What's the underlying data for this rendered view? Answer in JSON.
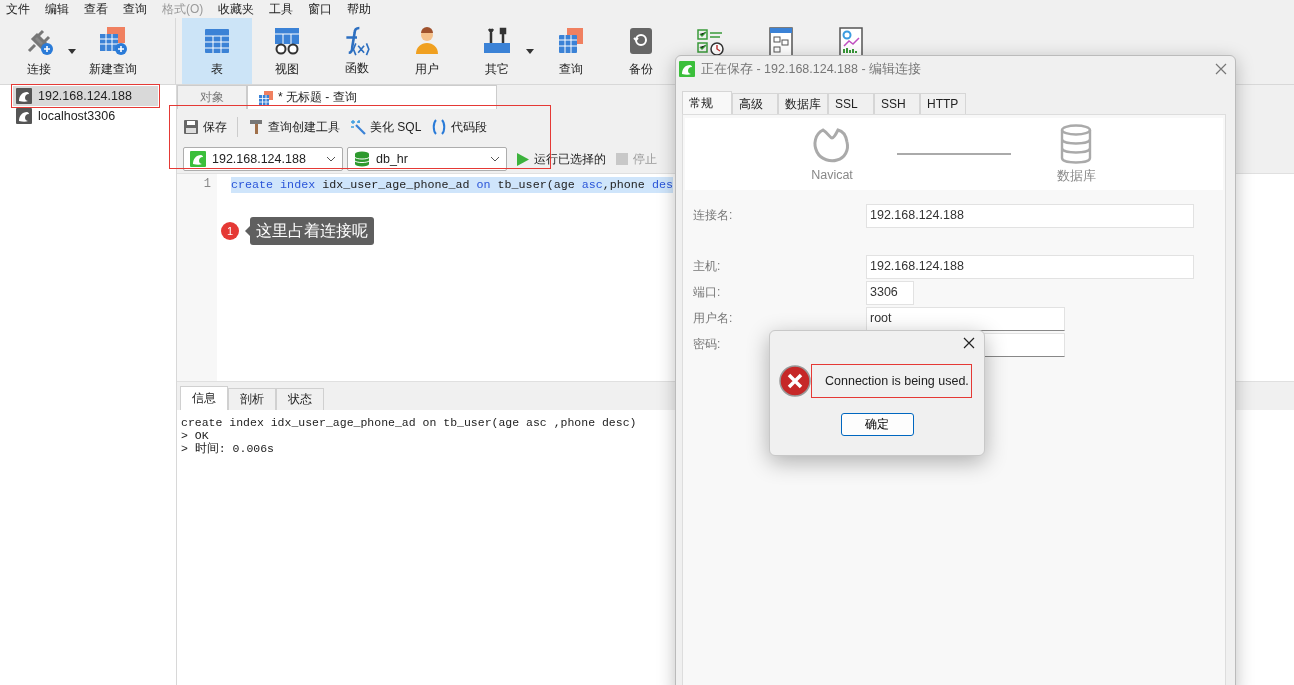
{
  "menu": [
    {
      "label": "文件",
      "disabled": false
    },
    {
      "label": "编辑",
      "disabled": false
    },
    {
      "label": "查看",
      "disabled": false
    },
    {
      "label": "查询",
      "disabled": false
    },
    {
      "label": "格式(O)",
      "disabled": true
    },
    {
      "label": "收藏夹",
      "disabled": false
    },
    {
      "label": "工具",
      "disabled": false
    },
    {
      "label": "窗口",
      "disabled": false
    },
    {
      "label": "帮助",
      "disabled": false
    }
  ],
  "toolbar": {
    "left": [
      {
        "label": "连接",
        "kind": "plug",
        "dropdown": true
      },
      {
        "label": "新建查询",
        "kind": "newquery"
      }
    ],
    "main": [
      {
        "label": "表",
        "kind": "table",
        "selected": true
      },
      {
        "label": "视图",
        "kind": "view",
        "selected": false
      },
      {
        "label": "函数",
        "kind": "function",
        "selected": false
      },
      {
        "label": "用户",
        "kind": "user",
        "selected": false
      },
      {
        "label": "其它",
        "kind": "tools",
        "selected": false,
        "dropdown": true
      },
      {
        "label": "查询",
        "kind": "query",
        "selected": false
      },
      {
        "label": "备份",
        "kind": "backup",
        "selected": false
      },
      {
        "kind": "schedule",
        "selected": false
      },
      {
        "kind": "model",
        "selected": false
      },
      {
        "kind": "chart",
        "selected": false
      }
    ]
  },
  "sidebar": {
    "items": [
      {
        "label": "192.168.124.188",
        "selected": true,
        "highlighted": true
      },
      {
        "label": "localhost3306",
        "selected": false,
        "highlighted": false
      }
    ]
  },
  "doc_tabs": [
    {
      "label": "对象",
      "kind": "objects",
      "selected": false
    },
    {
      "label": "* 无标题 - 查询",
      "kind": "query",
      "selected": true
    }
  ],
  "query_toolbar": [
    {
      "label": "保存",
      "kind": "save"
    },
    {
      "label": "查询创建工具",
      "kind": "hammer"
    },
    {
      "label": "美化 SQL",
      "kind": "wand"
    },
    {
      "label": "代码段",
      "kind": "braces"
    }
  ],
  "connection_select": {
    "value": "192.168.124.188"
  },
  "database_select": {
    "value": "db_hr"
  },
  "run": {
    "label": "运行已选择的"
  },
  "stop": {
    "label": "停止",
    "disabled": true
  },
  "editor": {
    "lines": [
      {
        "number": "1",
        "selected": true,
        "tokens": [
          {
            "text": "create",
            "kind": "keyword"
          },
          {
            "text": " index",
            "kind": "keyword"
          },
          {
            "text": " idx_user_age_phone_ad ",
            "kind": "plain"
          },
          {
            "text": "on",
            "kind": "keyword"
          },
          {
            "text": " tb_user(age ",
            "kind": "plain"
          },
          {
            "text": "asc",
            "kind": "keyword"
          },
          {
            "text": ",phone ",
            "kind": "plain"
          },
          {
            "text": "des",
            "kind": "keyword"
          }
        ]
      }
    ]
  },
  "annotation": {
    "number": "1",
    "text": "这里占着连接呢",
    "framed": true
  },
  "result_tabs": [
    {
      "label": "信息",
      "selected": true
    },
    {
      "label": "剖析",
      "selected": false
    },
    {
      "label": "状态",
      "selected": false
    }
  ],
  "log": [
    "create index idx_user_age_phone_ad on tb_user(age asc ,phone desc)",
    "> OK",
    "> 时间: 0.006s"
  ],
  "edit_dialog": {
    "title": "正在保存 - 192.168.124.188 - 编辑连接",
    "tabs": [
      {
        "label": "常规",
        "selected": true
      },
      {
        "label": "高级",
        "selected": false
      },
      {
        "label": "数据库",
        "selected": false
      },
      {
        "label": "SSL",
        "selected": false
      },
      {
        "label": "SSH",
        "selected": false
      },
      {
        "label": "HTTP",
        "selected": false
      }
    ],
    "diagram": {
      "left": "Navicat",
      "right": "数据库"
    },
    "sections": [
      {
        "fields": [
          {
            "label": "连接名:",
            "value": "192.168.124.188",
            "kind": "long"
          }
        ]
      },
      {
        "fields": [
          {
            "label": "主机:",
            "value": "192.168.124.188",
            "kind": "long"
          },
          {
            "label": "端口:",
            "value": "3306",
            "kind": "short"
          },
          {
            "label": "用户名:",
            "value": "root",
            "kind": "medium"
          },
          {
            "label": "密码:",
            "kind": "medium"
          }
        ]
      }
    ]
  },
  "message_box": {
    "message": "Connection is being used.",
    "highlighted": true,
    "button": "确定"
  }
}
